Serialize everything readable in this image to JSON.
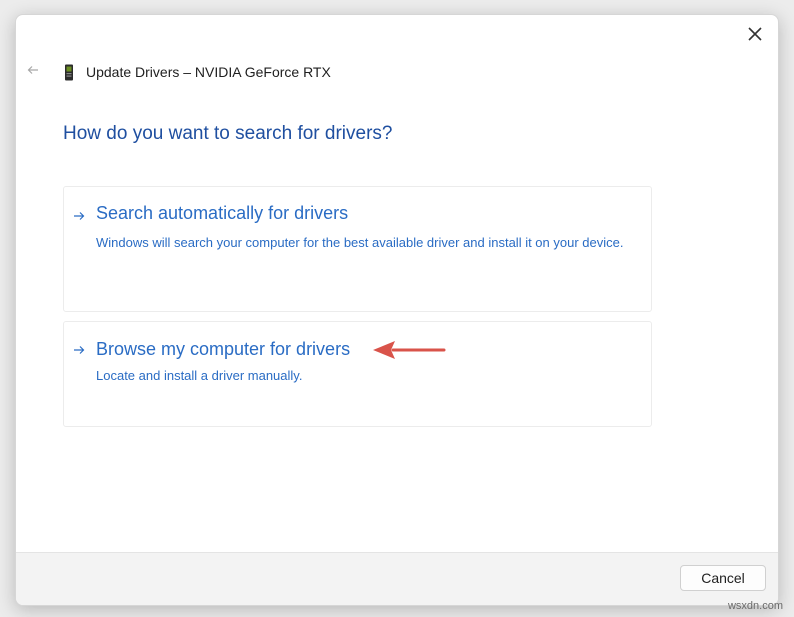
{
  "dialog": {
    "title": "Update Drivers – NVIDIA GeForce RTX",
    "question": "How do you want to search for drivers?",
    "options": [
      {
        "title": "Search automatically for drivers",
        "description": "Windows will search your computer for the best available driver and install it on your device."
      },
      {
        "title": "Browse my computer for drivers",
        "description": "Locate and install a driver manually."
      }
    ],
    "footer": {
      "cancel_label": "Cancel"
    }
  },
  "icons": {
    "close": "close-icon",
    "back": "back-arrow-icon",
    "device": "graphics-card-icon",
    "option_arrow": "arrow-right-icon",
    "annotation": "red-arrow-annotation"
  },
  "colors": {
    "accent": "#2a6cc4",
    "question": "#1f4fa0",
    "annotation": "#d9534a"
  },
  "watermark": "wsxdn.com"
}
